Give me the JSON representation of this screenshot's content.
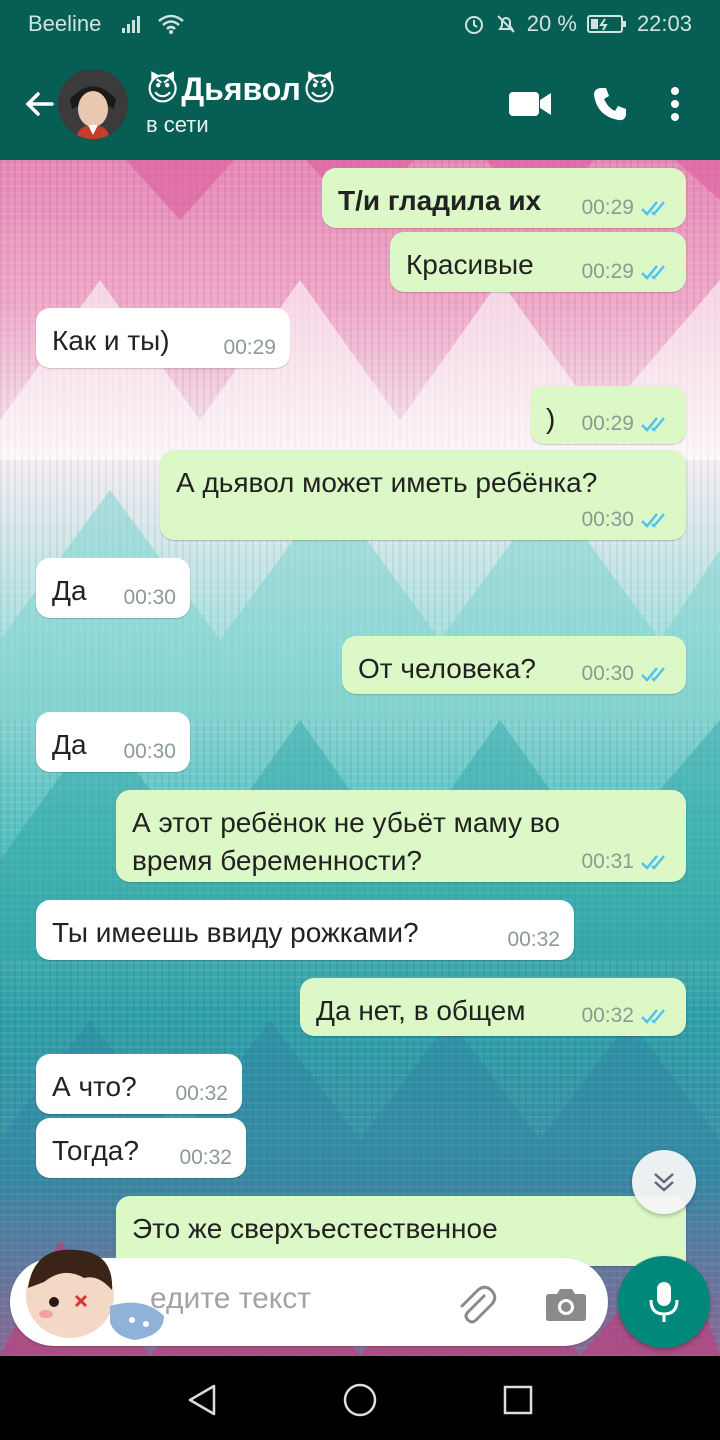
{
  "status_bar": {
    "carrier": "Beeline",
    "battery": "20 %",
    "time": "22:03"
  },
  "header": {
    "contact_name": "Дьявол",
    "emoji": "😈",
    "status": "в сети"
  },
  "messages": [
    {
      "dir": "out",
      "text": "Т/и гладила их",
      "time": "00:29",
      "bold": true
    },
    {
      "dir": "out",
      "text": "Красивые",
      "time": "00:29"
    },
    {
      "dir": "in",
      "text": "Как и ты)",
      "time": "00:29"
    },
    {
      "dir": "out",
      "text": ")",
      "time": "00:29"
    },
    {
      "dir": "out",
      "text": "А дьявол может иметь ребёнка?",
      "time": "00:30"
    },
    {
      "dir": "in",
      "text": "Да",
      "time": "00:30"
    },
    {
      "dir": "out",
      "text": "От человека?",
      "time": "00:30"
    },
    {
      "dir": "in",
      "text": "Да",
      "time": "00:30"
    },
    {
      "dir": "out",
      "text": "А этот ребёнок не убьёт маму во время беременности?",
      "time": "00:31"
    },
    {
      "dir": "in",
      "text": "Ты имеешь ввиду рожками?",
      "time": "00:32"
    },
    {
      "dir": "out",
      "text": "Да нет, в общем",
      "time": "00:32"
    },
    {
      "dir": "in",
      "text": "А что?",
      "time": "00:32"
    },
    {
      "dir": "in",
      "text": "Тогда?",
      "time": "00:32"
    },
    {
      "dir": "out",
      "text": "Это же сверхъестественное",
      "time": ""
    }
  ],
  "input": {
    "placeholder": "едите текст"
  },
  "colors": {
    "header_bg": "#075e54",
    "outgoing_bubble": "#dcf8c6",
    "incoming_bubble": "#ffffff",
    "tick_blue": "#4fc3f7",
    "mic_button": "#00897b"
  },
  "icons": [
    "back-arrow-icon",
    "video-call-icon",
    "phone-icon",
    "more-menu-icon",
    "double-check-icon",
    "scroll-down-icon",
    "attach-icon",
    "camera-icon",
    "mic-icon",
    "nav-back-icon",
    "nav-home-icon",
    "nav-recents-icon"
  ]
}
